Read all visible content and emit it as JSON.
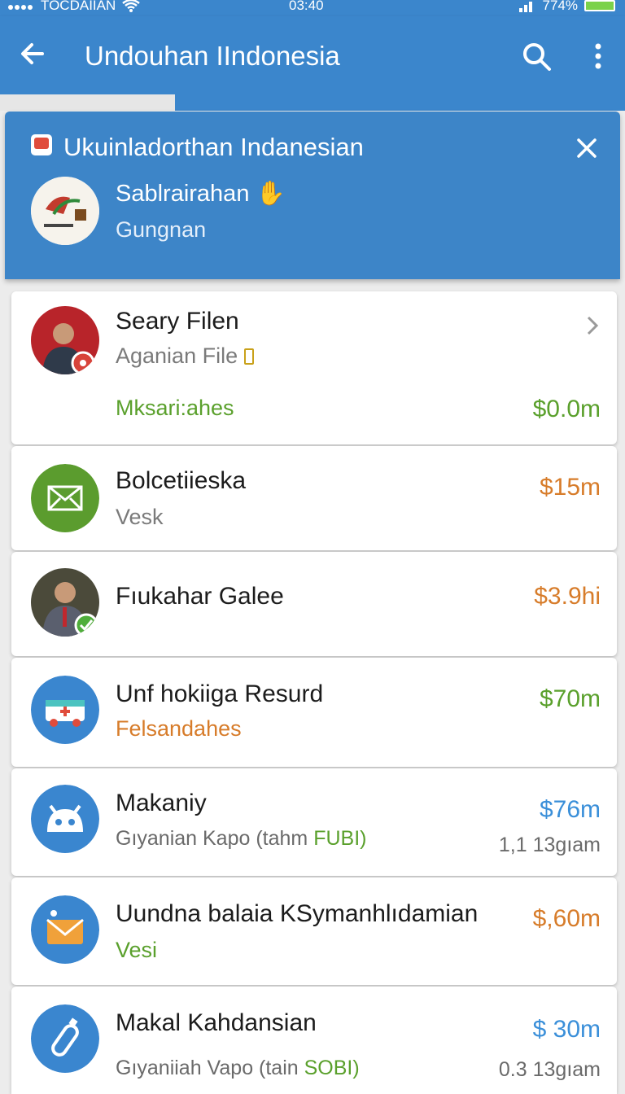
{
  "status_bar": {
    "carrier": "TOCDAIIAN",
    "time": "03:40",
    "battery": "774%"
  },
  "app_bar": {
    "title": "Undouhan IIndonesia"
  },
  "banner": {
    "title": "Ukuinladorthan Indanesian",
    "name": "Sablrairahan",
    "subtitle": "Gungnan"
  },
  "progress": {
    "value": 0.28
  },
  "items": [
    {
      "title": "Seary Filen",
      "subtitle": "Aganian File",
      "tag": "Mksari:ahes",
      "amount": "$0.0m",
      "amount_color": "#5aa02c"
    },
    {
      "title": "Bolcetiieska",
      "subtitle": "Vesk",
      "amount": "$15m",
      "amount_color": "#d77c2a"
    },
    {
      "title": "Fıukahar Galee",
      "amount": "$3.9hi",
      "amount_color": "#d77c2a"
    },
    {
      "title": "Unf hokiiga Resurd",
      "subtitle": "Felsandahes",
      "amount": "$70m",
      "amount_color": "#5aa02c"
    },
    {
      "title": "Makaniy",
      "subtitle_main": "Gıyanian Kapo (tahm",
      "subtitle_accent": "FUBI)",
      "amount": "$76m",
      "meta": "1,1 13gıam",
      "amount_color": "#3a8fd9"
    },
    {
      "title": "Uundna balaia KSymanhlıdamian",
      "subtitle": "Vesi",
      "amount": "$,60m",
      "amount_color": "#d77c2a"
    },
    {
      "title": "Makal Kahdansian",
      "subtitle_main": "Gıyaniiah Vapo (tain",
      "subtitle_accent": "SOBI)",
      "amount": "$ 30m",
      "meta": "0.3 13gıam",
      "amount_color": "#3a8fd9"
    }
  ]
}
